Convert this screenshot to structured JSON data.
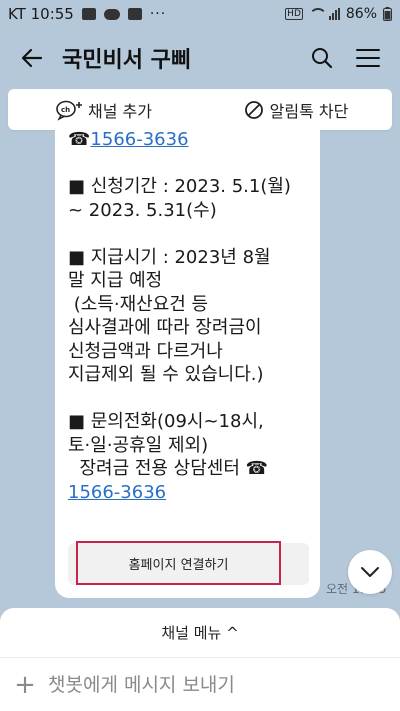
{
  "status_bar": {
    "carrier_time": "KT 10:55",
    "more": "···",
    "hd": "HD",
    "battery": "86%"
  },
  "header": {
    "title": "국민비서 구삐"
  },
  "channel_bar": {
    "add_label": "채널 추가",
    "block_label": "알림톡 차단"
  },
  "message": {
    "top_phone": "1566-3636",
    "line_apply_1": "■ 신청기간 : 2023. 5.1(월)",
    "line_apply_2": "~ 2023. 5.31(수)",
    "line_pay_1": "■ 지급시기 : 2023년 8월",
    "line_pay_2": "말 지급 예정",
    "line_pay_3": " (소득·재산요건 등",
    "line_pay_4": "심사결과에 따라 장려금이",
    "line_pay_5": "신청금액과 다르거나",
    "line_pay_6": "지급제외 될 수 있습니다.)",
    "line_contact_1": "■ 문의전화(09시~18시,",
    "line_contact_2": "토·일·공휴일 제외)",
    "line_contact_3": "  장려금 전용 상담센터 ☎",
    "bottom_phone": "1566-3636",
    "home_button": "홈페이지 연결하기",
    "time": "오전 11:05"
  },
  "bottom": {
    "menu_label": "채널 메뉴 ^",
    "input_placeholder": "챗봇에게 메시지 보내기",
    "plus": "+"
  },
  "colors": {
    "background": "#b5c8da",
    "link": "#2a6fc5",
    "highlight_border": "#c8224f"
  }
}
